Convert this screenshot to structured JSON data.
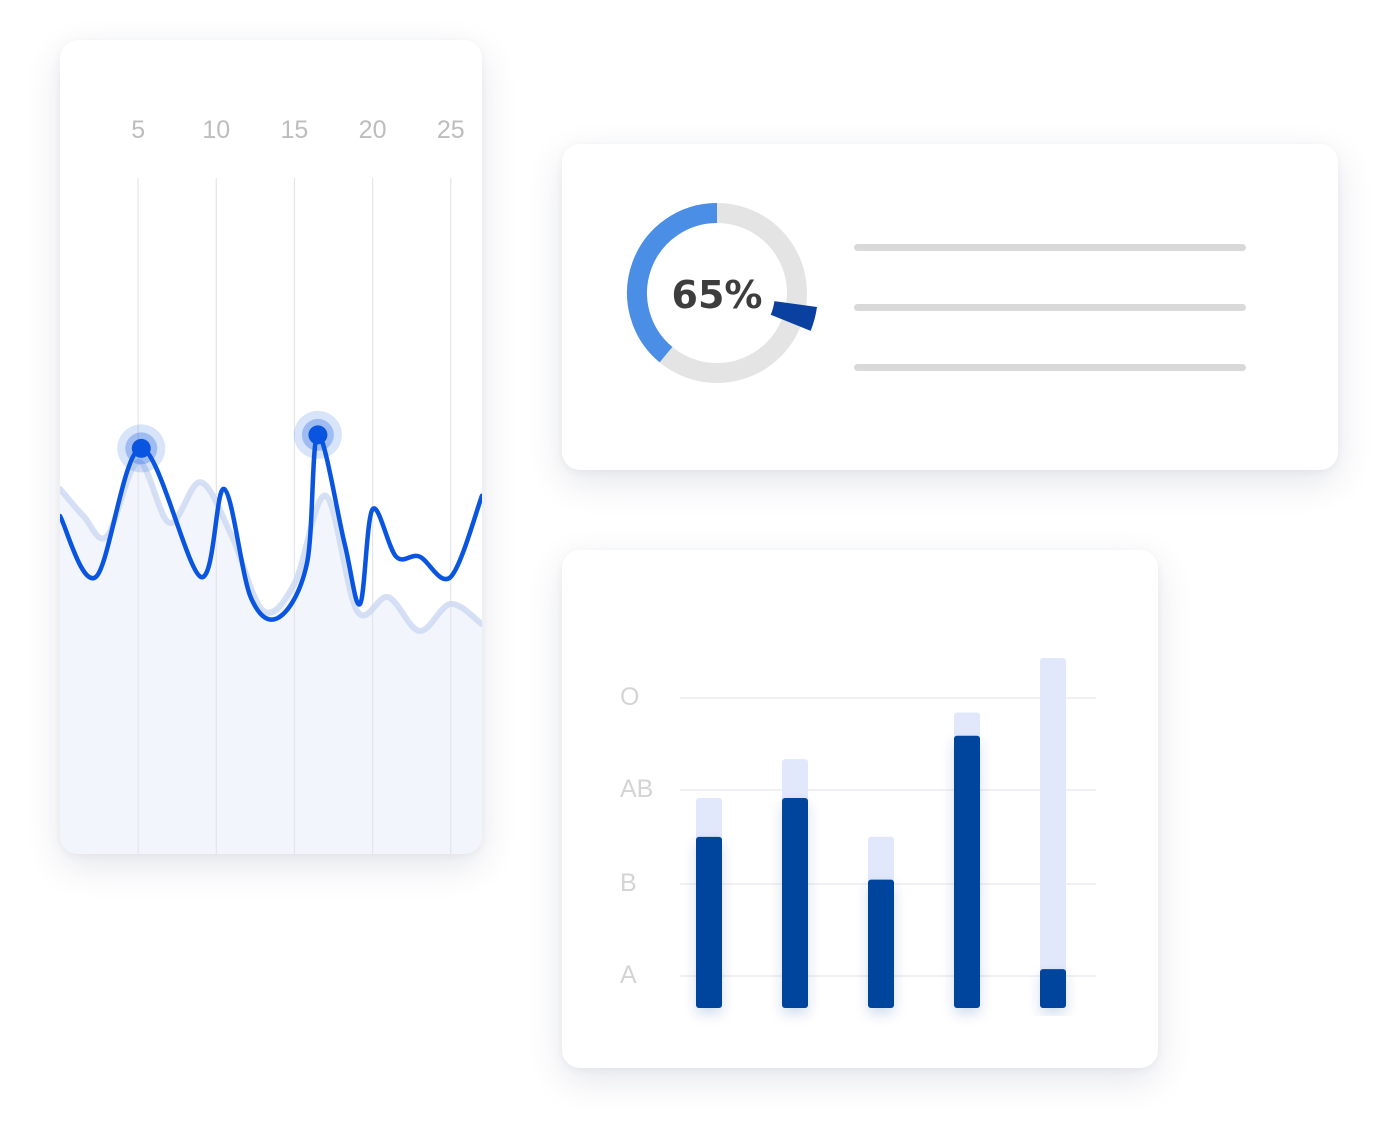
{
  "chart_data": [
    {
      "type": "line",
      "xlabel": "",
      "ylabel": "",
      "x_ticks": [
        "5",
        "10",
        "15",
        "20",
        "25"
      ],
      "xlim": [
        0,
        27
      ],
      "ylim": [
        0,
        100
      ],
      "grid": "vertical",
      "series": [
        {
          "role": "primary",
          "color": "#0A55E0",
          "x": [
            0,
            2.3,
            5.2,
            9,
            10.5,
            12.2,
            14,
            15.8,
            16.5,
            18.2,
            19.2,
            20,
            21.5,
            23,
            25,
            27
          ],
          "y": [
            50,
            41,
            60,
            41,
            54,
            38,
            35,
            43,
            62,
            46,
            37,
            51,
            44,
            44,
            41,
            53
          ]
        },
        {
          "role": "secondary",
          "color": "#C8D6F2",
          "x": [
            0,
            1.5,
            3,
            5,
            7,
            9,
            11,
            13,
            15,
            17,
            19,
            21,
            23,
            25,
            27
          ],
          "y": [
            54,
            50,
            47,
            58,
            49,
            55,
            47,
            36,
            40,
            53,
            36,
            38,
            33,
            37,
            34
          ]
        }
      ],
      "highlighted_points": [
        {
          "x": 5.2,
          "y": 60
        },
        {
          "x": 16.5,
          "y": 62
        }
      ]
    },
    {
      "type": "pie",
      "label": "65%",
      "value": 65,
      "colors": {
        "progress": "#4A8EE6",
        "track": "#E4E4E4",
        "marker": "#0A41A0"
      },
      "legend_lines": 3
    },
    {
      "type": "bar",
      "categories": [
        "",
        "",
        "",
        "",
        ""
      ],
      "y_ticks": [
        "A",
        "B",
        "AB",
        "O"
      ],
      "series": [
        {
          "role": "total",
          "color": "#E1E8FB",
          "values": [
            2.7,
            3.2,
            2.2,
            3.8,
            4.5
          ]
        },
        {
          "role": "value",
          "color": "#03449D",
          "values": [
            2.2,
            2.7,
            1.65,
            3.5,
            0.5
          ]
        }
      ],
      "ylim": [
        0,
        4.5
      ],
      "grid": "horizontal"
    }
  ]
}
